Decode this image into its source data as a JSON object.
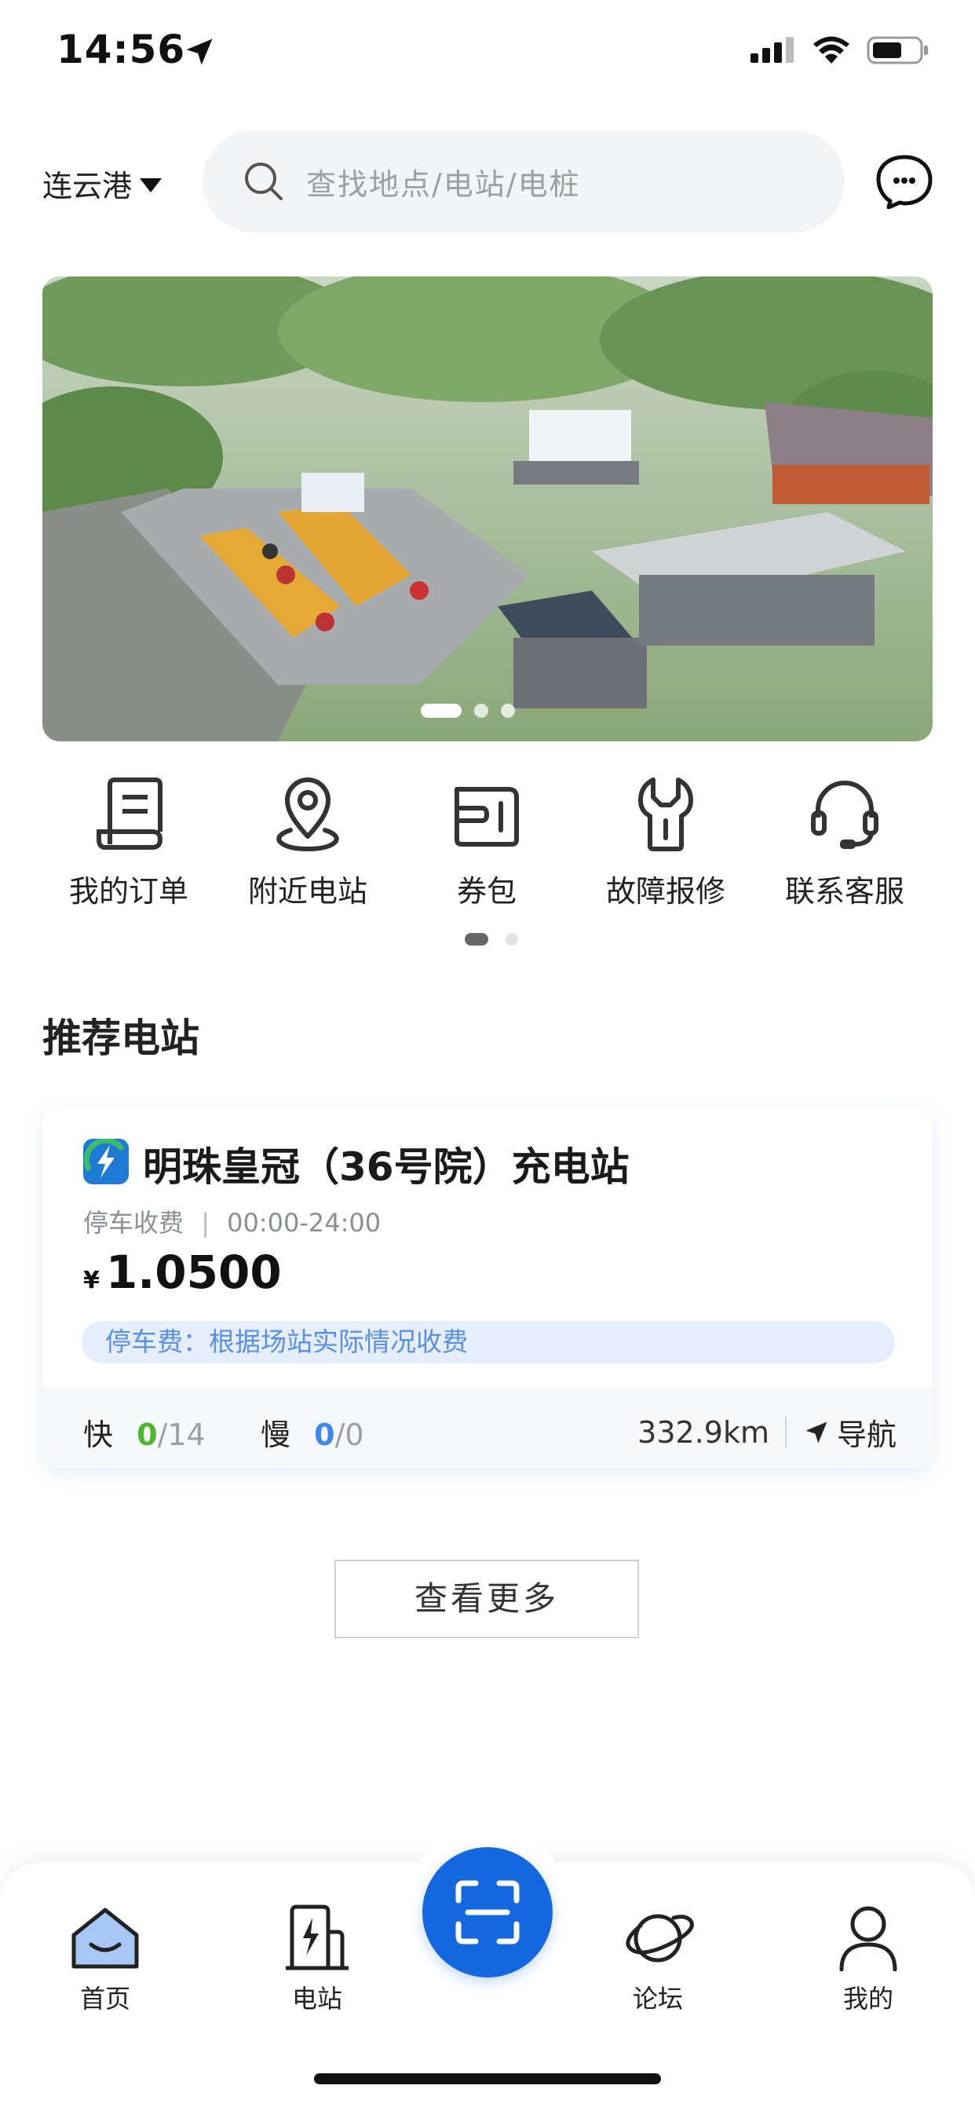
{
  "status_bar": {
    "time": "14:56"
  },
  "header": {
    "city": "连云港",
    "search_placeholder": "查找地点/电站/电桩"
  },
  "quick_menu": [
    {
      "label": "我的订单",
      "icon": "order-icon"
    },
    {
      "label": "附近电站",
      "icon": "location-pin-icon"
    },
    {
      "label": "券包",
      "icon": "coupon-wallet-icon"
    },
    {
      "label": "故障报修",
      "icon": "wrench-icon"
    },
    {
      "label": "联系客服",
      "icon": "headset-icon"
    }
  ],
  "section": {
    "title": "推荐电站"
  },
  "station": {
    "name": "明珠皇冠（36号院）充电站",
    "parking": "停车收费",
    "hours": "00:00-24:00",
    "currency": "¥",
    "price": "1.0500",
    "tag": "停车费：根据场站实际情况收费",
    "fast_label": "快",
    "fast_available": "0",
    "fast_total": "/14",
    "slow_label": "慢",
    "slow_available": "0",
    "slow_total": "/0",
    "distance": "332.9km",
    "nav_label": "导航"
  },
  "more_button": "查看更多",
  "tabs": [
    {
      "label": "首页",
      "icon": "home-icon"
    },
    {
      "label": "电站",
      "icon": "charging-station-icon"
    },
    {
      "label": "",
      "icon": "scan-icon"
    },
    {
      "label": "论坛",
      "icon": "planet-icon"
    },
    {
      "label": "我的",
      "icon": "user-icon"
    }
  ],
  "colors": {
    "accent": "#1567e0",
    "fast": "#4cb830",
    "slow": "#3f86ee",
    "tag_bg": "#e4eefd"
  }
}
